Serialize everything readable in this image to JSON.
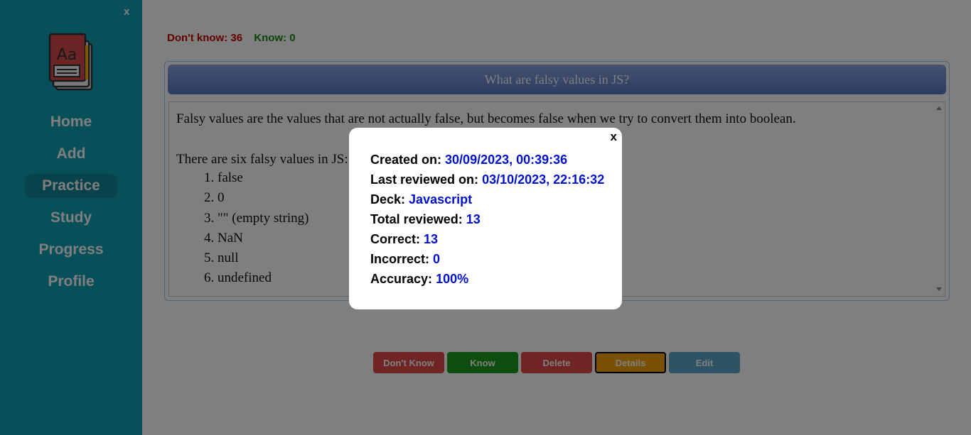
{
  "sidebar": {
    "close_label": "x",
    "logo_letters": "Aa",
    "items": [
      {
        "label": "Home"
      },
      {
        "label": "Add"
      },
      {
        "label": "Practice"
      },
      {
        "label": "Study"
      },
      {
        "label": "Progress"
      },
      {
        "label": "Profile"
      }
    ],
    "active_index": 2
  },
  "counters": {
    "dont_know": "Don't know: 36",
    "know": "Know: 0"
  },
  "card": {
    "question": "What are falsy values in JS?",
    "answer_intro": "Falsy values are the values that are not actually false, but becomes false when we try to convert them into boolean.",
    "answer_list_intro": "There are six falsy values in JS:",
    "answer_items": [
      "false",
      "0",
      "\"\" (empty string)",
      "NaN",
      "null",
      "undefined"
    ]
  },
  "buttons": {
    "dont_know": "Don't Know",
    "know": "Know",
    "delete": "Delete",
    "details": "Details",
    "edit": "Edit"
  },
  "modal": {
    "close_label": "x",
    "created_label": "Created on:",
    "created_value": "30/09/2023, 00:39:36",
    "reviewed_label": "Last reviewed on:",
    "reviewed_value": "03/10/2023, 22:16:32",
    "deck_label": "Deck:",
    "deck_value": "Javascript",
    "total_label": "Total reviewed:",
    "total_value": "13",
    "correct_label": "Correct:",
    "correct_value": "13",
    "incorrect_label": "Incorrect:",
    "incorrect_value": "0",
    "accuracy_label": "Accuracy:",
    "accuracy_value": "100%"
  },
  "colors": {
    "sidebar": "#0f9fb2",
    "dont_know_btn": "#e04848",
    "know_btn": "#1a9a1a",
    "delete_btn": "#e04848",
    "details_btn": "#f5a10a",
    "edit_btn": "#5ca6c9",
    "value_blue": "#0010d0"
  }
}
